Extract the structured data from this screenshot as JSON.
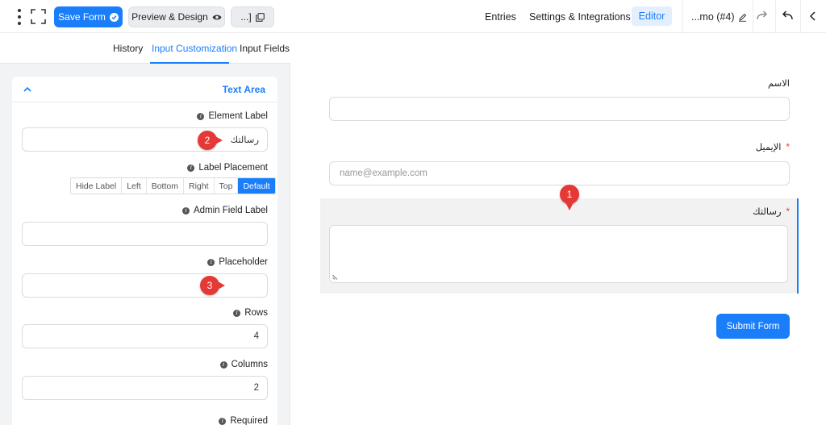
{
  "toolbar": {
    "save_label": "Save Form",
    "preview_label": "Preview & Design",
    "shortcode_label": "...]"
  },
  "nav": {
    "entries": "Entries",
    "settings": "Settings & Integrations",
    "editor": "Editor",
    "form_title": "...mo (#4)"
  },
  "tabs": {
    "history": "History",
    "input_customization": "Input Customization",
    "input_fields": "Input Fields"
  },
  "panel": {
    "section_title": "Text Area",
    "element_label": {
      "label": "Element Label",
      "value": "رسالتك"
    },
    "label_placement": {
      "label": "Label Placement",
      "options": [
        "Hide Label",
        "Left",
        "Bottom",
        "Right",
        "Top",
        "Default"
      ],
      "selected": "Default"
    },
    "admin_field_label": {
      "label": "Admin Field Label",
      "value": ""
    },
    "placeholder": {
      "label": "Placeholder",
      "value": ""
    },
    "rows": {
      "label": "Rows",
      "value": "4"
    },
    "columns": {
      "label": "Columns",
      "value": "2"
    },
    "required": {
      "label": "Required"
    }
  },
  "callouts": [
    "1",
    "2",
    "3"
  ],
  "form": {
    "name": {
      "label": "الاسم",
      "placeholder": ""
    },
    "email": {
      "label": "الإيميل",
      "required_mark": "*",
      "placeholder": "name@example.com"
    },
    "message": {
      "label": "رسالتك",
      "required_mark": "*"
    },
    "submit_label": "Submit Form"
  },
  "colors": {
    "accent": "#1a7efb",
    "callout": "#e53935",
    "panel_bg": "#f2f3f5"
  }
}
